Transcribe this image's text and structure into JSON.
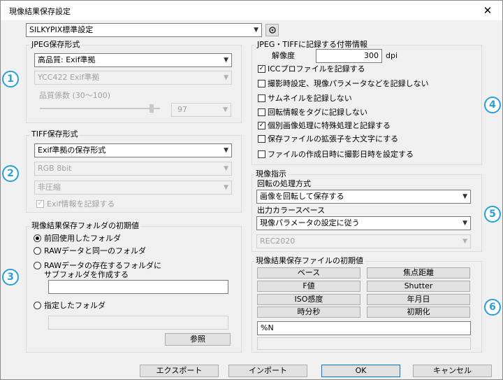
{
  "window": {
    "title": "現像結果保存設定",
    "close": "✕"
  },
  "preset": {
    "value": "SILKYPIX標準設定",
    "button_icon": "gear-icon"
  },
  "jpeg": {
    "title": "JPEG保存形式",
    "format": "高品質:  Exif準拠",
    "subsample": "YCC422 Exif準拠",
    "quality_label": "品質係数 (30〜100)",
    "quality_value": "97",
    "quality_level": 97
  },
  "tiff": {
    "title": "TIFF保存形式",
    "format": "Exif準拠の保存形式",
    "color": "RGB 8bit",
    "compression": "非圧縮",
    "exif_label": "Exif情報を記録する",
    "exif_checked": true
  },
  "folder": {
    "title": "現像結果保存フォルダの初期値",
    "option1": "前回使用したフォルダ",
    "option2": "RAWデータと同一のフォルダ",
    "option3_line1": "RAWデータの存在するフォルダに",
    "option3_line2": "サブフォルダを作成する",
    "subfolder_value": "",
    "option4": "指定したフォルダ",
    "folder_value": "",
    "browse": "参照"
  },
  "embed": {
    "title": "JPEG・TIFFに記録する付帯情報",
    "resolution_label": "解像度",
    "resolution_value": "300",
    "resolution_unit": "dpi",
    "items": [
      {
        "label": "ICCプロファイルを記録する",
        "checked": true
      },
      {
        "label": "撮影時設定、現像パラメータなどを記録しない",
        "checked": false
      },
      {
        "label": "サムネイルを記録しない",
        "checked": false
      },
      {
        "label": "回転情報をタグに記録しない",
        "checked": false
      },
      {
        "label": "個別画像処理に特殊処理と記録する",
        "checked": true
      },
      {
        "label": "保存ファイルの拡張子を大文字にする",
        "checked": false
      },
      {
        "label": "ファイルの作成日時に撮影日時を設定する",
        "checked": false
      }
    ]
  },
  "develop": {
    "title": "現像指示",
    "rotation_label": "回転の処理方式",
    "rotation_value": "画像を回転して保存する",
    "colorspace_label": "出力カラースペース",
    "colorspace_value": "現像パラメータの設定に従う",
    "rec_value": "REC2020"
  },
  "filename": {
    "title": "現像結果保存ファイルの初期値",
    "buttons": [
      "ベース",
      "焦点距離",
      "F値",
      "Shutter",
      "ISO感度",
      "年月日",
      "時分秒",
      "初期化"
    ],
    "pattern": "%N",
    "preview": ""
  },
  "footer": {
    "export": "エクスポート",
    "import": "インポート",
    "ok": "OK",
    "cancel": "キャンセル"
  },
  "badges": [
    "1",
    "2",
    "3",
    "4",
    "5",
    "6"
  ]
}
